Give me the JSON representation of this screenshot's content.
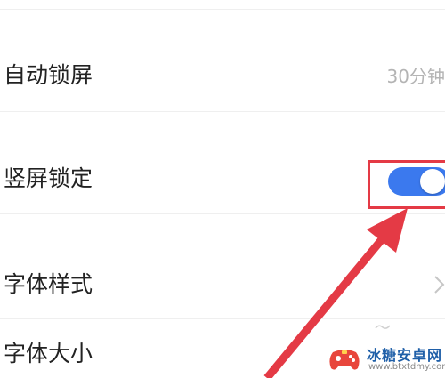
{
  "settings": {
    "items": [
      {
        "label": "自动锁屏",
        "value": "30分钟"
      },
      {
        "label": "竖屏锁定",
        "toggle_on": true
      },
      {
        "label": "字体样式",
        "chevron": true
      },
      {
        "label": "字体大小"
      }
    ]
  },
  "colors": {
    "toggle_on": "#3b79ee",
    "annotation": "#e43a45"
  },
  "watermark": {
    "title": "冰糖安卓网",
    "url": "www.btxtdmy.com"
  }
}
